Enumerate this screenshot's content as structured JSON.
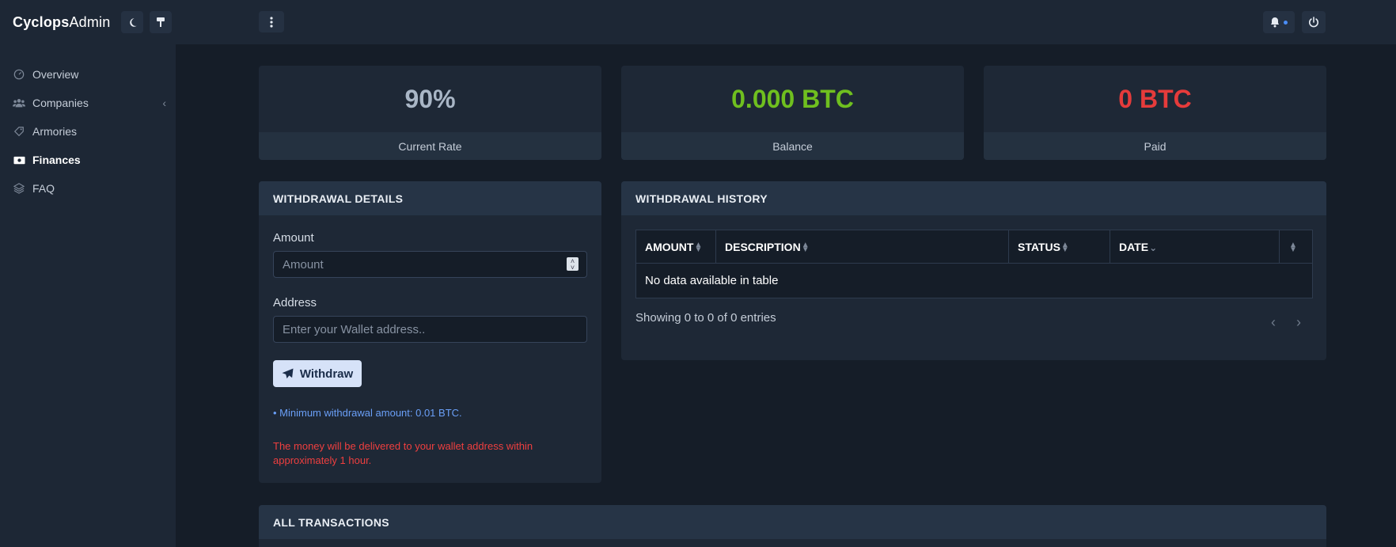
{
  "brand": {
    "bold": "Cyclops",
    "regular": "Admin",
    "theme_icon": "moon-icon",
    "paint_icon": "paint-roller-icon"
  },
  "sidebar": {
    "items": [
      {
        "label": "Overview",
        "icon": "gauge-icon",
        "active": false
      },
      {
        "label": "Companies",
        "icon": "users-icon",
        "active": false,
        "has_children": true
      },
      {
        "label": "Armories",
        "icon": "tag-icon",
        "active": false
      },
      {
        "label": "Finances",
        "icon": "money-bill-icon",
        "active": true
      },
      {
        "label": "FAQ",
        "icon": "layers-icon",
        "active": false
      }
    ]
  },
  "topbar": {
    "menu_icon": "dots-vertical-icon",
    "bell_icon": "bell-icon",
    "power_icon": "power-icon"
  },
  "stats": [
    {
      "value": "90%",
      "label": "Current Rate",
      "color": "#a9b6c6"
    },
    {
      "value": "0.000 BTC",
      "label": "Balance",
      "color": "#6fbf1f"
    },
    {
      "value": "0 BTC",
      "label": "Paid",
      "color": "#e53b3b"
    }
  ],
  "withdrawal_details": {
    "title": "WITHDRAWAL DETAILS",
    "amount_label": "Amount",
    "amount_placeholder": "Amount",
    "address_label": "Address",
    "address_placeholder": "Enter your Wallet address..",
    "button_label": "Withdraw",
    "hint": "• Minimum withdrawal amount: 0.01 BTC.",
    "warning": "The money will be delivered to your wallet address within approximately 1 hour."
  },
  "withdrawal_history": {
    "title": "WITHDRAWAL HISTORY",
    "columns": [
      "AMOUNT",
      "DESCRIPTION",
      "STATUS",
      "DATE",
      ""
    ],
    "empty_message": "No data available in table",
    "showing": "Showing 0 to 0 of 0 entries"
  },
  "all_transactions": {
    "title": "ALL TRANSACTIONS"
  },
  "colors": {
    "accent_blue": "#6a9ff7",
    "warning_red": "#ef3f3f",
    "balance_green": "#6fbf1f"
  }
}
